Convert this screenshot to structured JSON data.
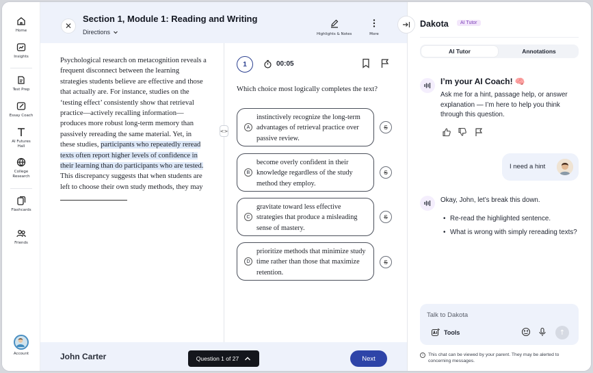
{
  "nav": {
    "items": [
      {
        "label": "Home",
        "icon": "home-icon"
      },
      {
        "label": "Insights",
        "icon": "insights-icon"
      },
      {
        "label": "Test Prep",
        "icon": "test-prep-icon"
      },
      {
        "label": "Essay Coach",
        "icon": "essay-coach-icon"
      },
      {
        "label": "AI Futures Hall",
        "icon": "ai-futures-icon"
      },
      {
        "label": "College Research",
        "icon": "college-icon"
      },
      {
        "label": "Flashcards",
        "icon": "flashcards-icon"
      },
      {
        "label": "Friends",
        "icon": "friends-icon"
      }
    ],
    "account_label": "Account"
  },
  "header": {
    "title": "Section 1, Module 1: Reading and Writing",
    "directions_label": "Directions",
    "highlights_label": "Highlights & Notes",
    "more_label": "More"
  },
  "passage": {
    "before": "Psychological research on metacognition reveals a frequent disconnect between the learning strategies students believe are effective and those that actually are. For instance, studies on the ‘testing effect’ consistently show that retrieval practice—actively recalling information—produces more robust long-term memory than passively rereading the same material. Yet, in these studies, ",
    "highlight": "participants who repeatedly reread texts often report higher levels of confidence in their learning than do participants who are tested.",
    "after": " This discrepancy suggests that when students are left to choose their own study methods, they may"
  },
  "question": {
    "number": "1",
    "timer": "00:05",
    "prompt": "Which choice most logically completes the text?",
    "choices": [
      {
        "letter": "A",
        "text": "instinctively recognize the long-term advantages of retrieval practice over passive review."
      },
      {
        "letter": "B",
        "text": "become overly confident in their knowledge regardless of the study method they employ."
      },
      {
        "letter": "C",
        "text": "gravitate toward less effective strategies that produce a misleading sense of mastery."
      },
      {
        "letter": "D",
        "text": "prioritize methods that minimize study time rather than those that maximize retention."
      }
    ],
    "strike_label": "S"
  },
  "footer": {
    "student_name": "John Carter",
    "question_counter": "Question 1 of 27",
    "next_label": "Next"
  },
  "panel": {
    "name": "Dakota",
    "badge": "AI Tutor",
    "tabs": [
      "AI Tutor",
      "Annotations"
    ],
    "active_tab": "AI Tutor",
    "coach_title": "I’m your AI Coach! 🧠",
    "coach_body": "Ask me for a hint, passage help, or answer explanation — I’m here to help you think through this question.",
    "user_message": "I need a hint",
    "reply": "Okay, John, let’s break this down.",
    "bullets": [
      "Re-read the highlighted sentence.",
      "What is wrong with simply rereading texts?"
    ],
    "input_placeholder": "Talk to Dakota",
    "tools_label": "Tools",
    "notice": "This chat can be viewed by your parent. They may be alerted to concerning messages."
  },
  "colors": {
    "accent": "#2e44a8",
    "topbar_bg": "#eef2fb",
    "highlight": "#dde8f8",
    "badge_bg": "#f3e7fb",
    "badge_text": "#7b3db8"
  }
}
